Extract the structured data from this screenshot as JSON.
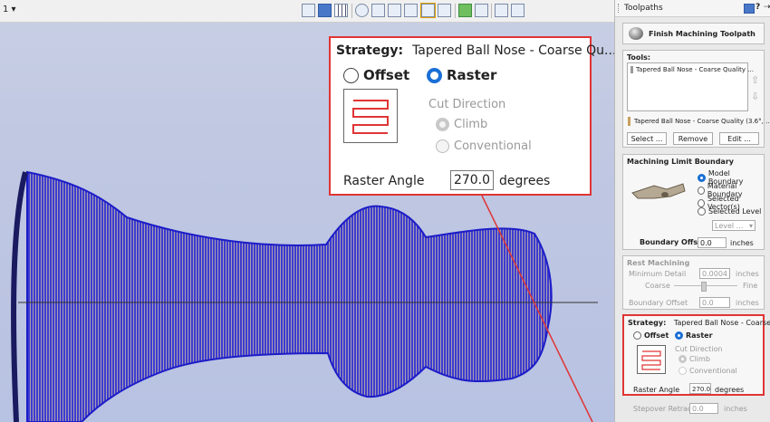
{
  "toolbar": {
    "view_label": "1 ▾"
  },
  "panel": {
    "title": "Toolpaths",
    "header_icons": [
      "panel-icon",
      "help-icon",
      "pin-icon"
    ],
    "toolpath_name": "Finish Machining Toolpath",
    "tools": {
      "title": "Tools:",
      "list_item": "Tapered Ball Nose - Coarse Quality ...",
      "selected_tool": "Tapered Ball Nose - Coarse Quality (3.6°, ...",
      "select_label": "Select ...",
      "remove_label": "Remove",
      "edit_label": "Edit ..."
    },
    "boundary": {
      "title": "Machining Limit Boundary",
      "options": [
        "Model Boundary",
        "Material Boundary",
        "Selected Vector(s)",
        "Selected Level"
      ],
      "selected": "Model Boundary",
      "level_dropdown": "Level ...",
      "offset_label": "Boundary Offset",
      "offset_value": "0.0",
      "offset_unit": "inches"
    },
    "rest": {
      "title": "Rest Machining",
      "min_detail_label": "Minimum Detail",
      "min_detail_value": "0.0004",
      "min_detail_unit": "inches",
      "coarse_label": "Coarse",
      "fine_label": "Fine",
      "offset_label": "Boundary Offset",
      "offset_value": "0.0",
      "offset_unit": "inches"
    },
    "strategy": {
      "label": "Strategy:",
      "value": "Tapered Ball Nose - Coarse Qu...",
      "offset_label": "Offset",
      "raster_label": "Raster",
      "selected": "Raster",
      "cut_direction_label": "Cut Direction",
      "climb_label": "Climb",
      "conventional_label": "Conventional",
      "raster_angle_label": "Raster Angle",
      "raster_angle_value": "270.0",
      "raster_angle_unit": "degrees"
    },
    "stepover": {
      "label": "Stepover Retract",
      "value": "0.0",
      "unit": "inches"
    }
  },
  "callout": {
    "strategy_label": "Strategy:",
    "strategy_value": "Tapered Ball Nose - Coarse Qu...",
    "offset_label": "Offset",
    "raster_label": "Raster",
    "cut_direction_label": "Cut Direction",
    "climb_label": "Climb",
    "conventional_label": "Conventional",
    "raster_angle_label": "Raster Angle",
    "raster_angle_value": "270.0",
    "raster_angle_unit": "degrees"
  },
  "colors": {
    "highlight": "#e03535",
    "accent": "#1a6fd6",
    "toolpath": "#1c1cc8"
  }
}
